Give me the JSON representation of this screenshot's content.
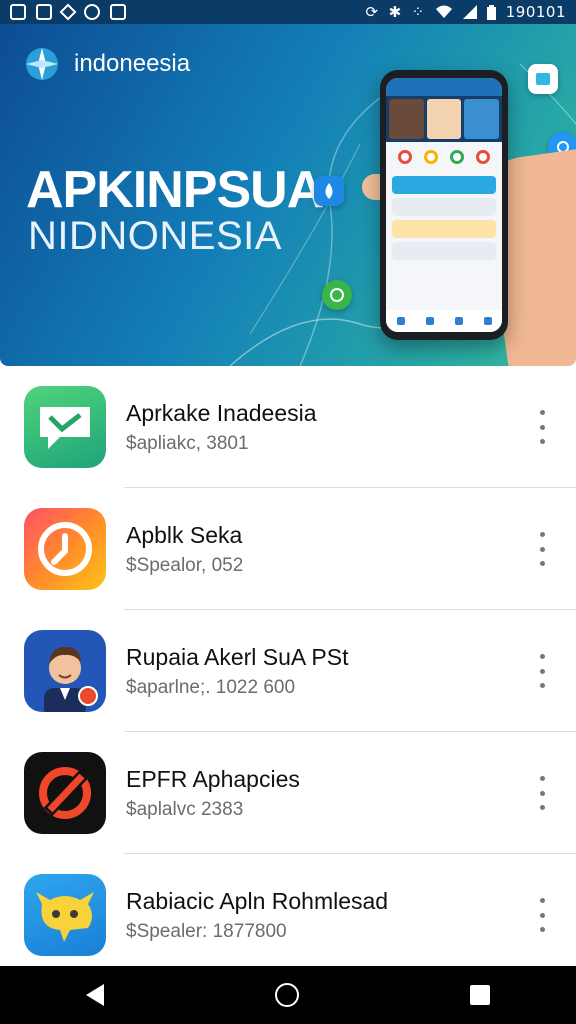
{
  "status_bar": {
    "left_icons": [
      "image-icon",
      "photo-icon",
      "bug-icon",
      "circle-icon",
      "picture-icon"
    ],
    "right_icons": [
      "sync-icon",
      "bluetooth-icon",
      "signal-dots-icon",
      "wifi-icon",
      "cell-signal-icon",
      "battery-icon"
    ],
    "time": "190101"
  },
  "banner": {
    "brand_name": "indoneesia",
    "headline": "APKINPSUA",
    "subheadline": "NIDNONESIA",
    "colors": {
      "gradient_start": "#0d4c94",
      "gradient_end": "#3bbd9c"
    }
  },
  "apps": [
    {
      "title": "Aprkake Inadeesia",
      "subtitle": "$apliakc, 3801",
      "icon": "chat-bubble-icon"
    },
    {
      "title": "Apblk Seka",
      "subtitle": "$Spealor, 052",
      "icon": "timer-badge-icon"
    },
    {
      "title": "Rupaia Akerl SuA PSt",
      "subtitle": "$aparlne;. 1022 600",
      "icon": "avatar-man-icon"
    },
    {
      "title": "EPFR Aphapcies",
      "subtitle": "$aplalvc 2383",
      "icon": "slash-circle-icon"
    },
    {
      "title": "Rabiacic Apln Rohmlesad",
      "subtitle": "$Spealer: 1877800",
      "icon": "robot-face-icon"
    }
  ],
  "nav_bar": {
    "back": "back-icon",
    "home": "home-icon",
    "recents": "recents-icon"
  }
}
